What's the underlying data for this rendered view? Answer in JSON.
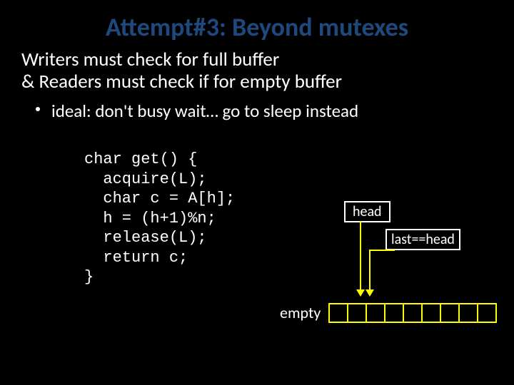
{
  "title": "Attempt#3: Beyond mutexes",
  "line1": "Writers must check for full buffer",
  "line2": "& Readers must check if for empty buffer",
  "bullet1": "ideal: don't busy wait… go to sleep instead",
  "code": "char get() {\n  acquire(L);\n  char c = A[h];\n  h = (h+1)%n;\n  release(L);\n  return c;\n}",
  "labels": {
    "head": "head",
    "last": "last==head",
    "empty": "empty"
  },
  "buffer": {
    "cells": 9
  }
}
